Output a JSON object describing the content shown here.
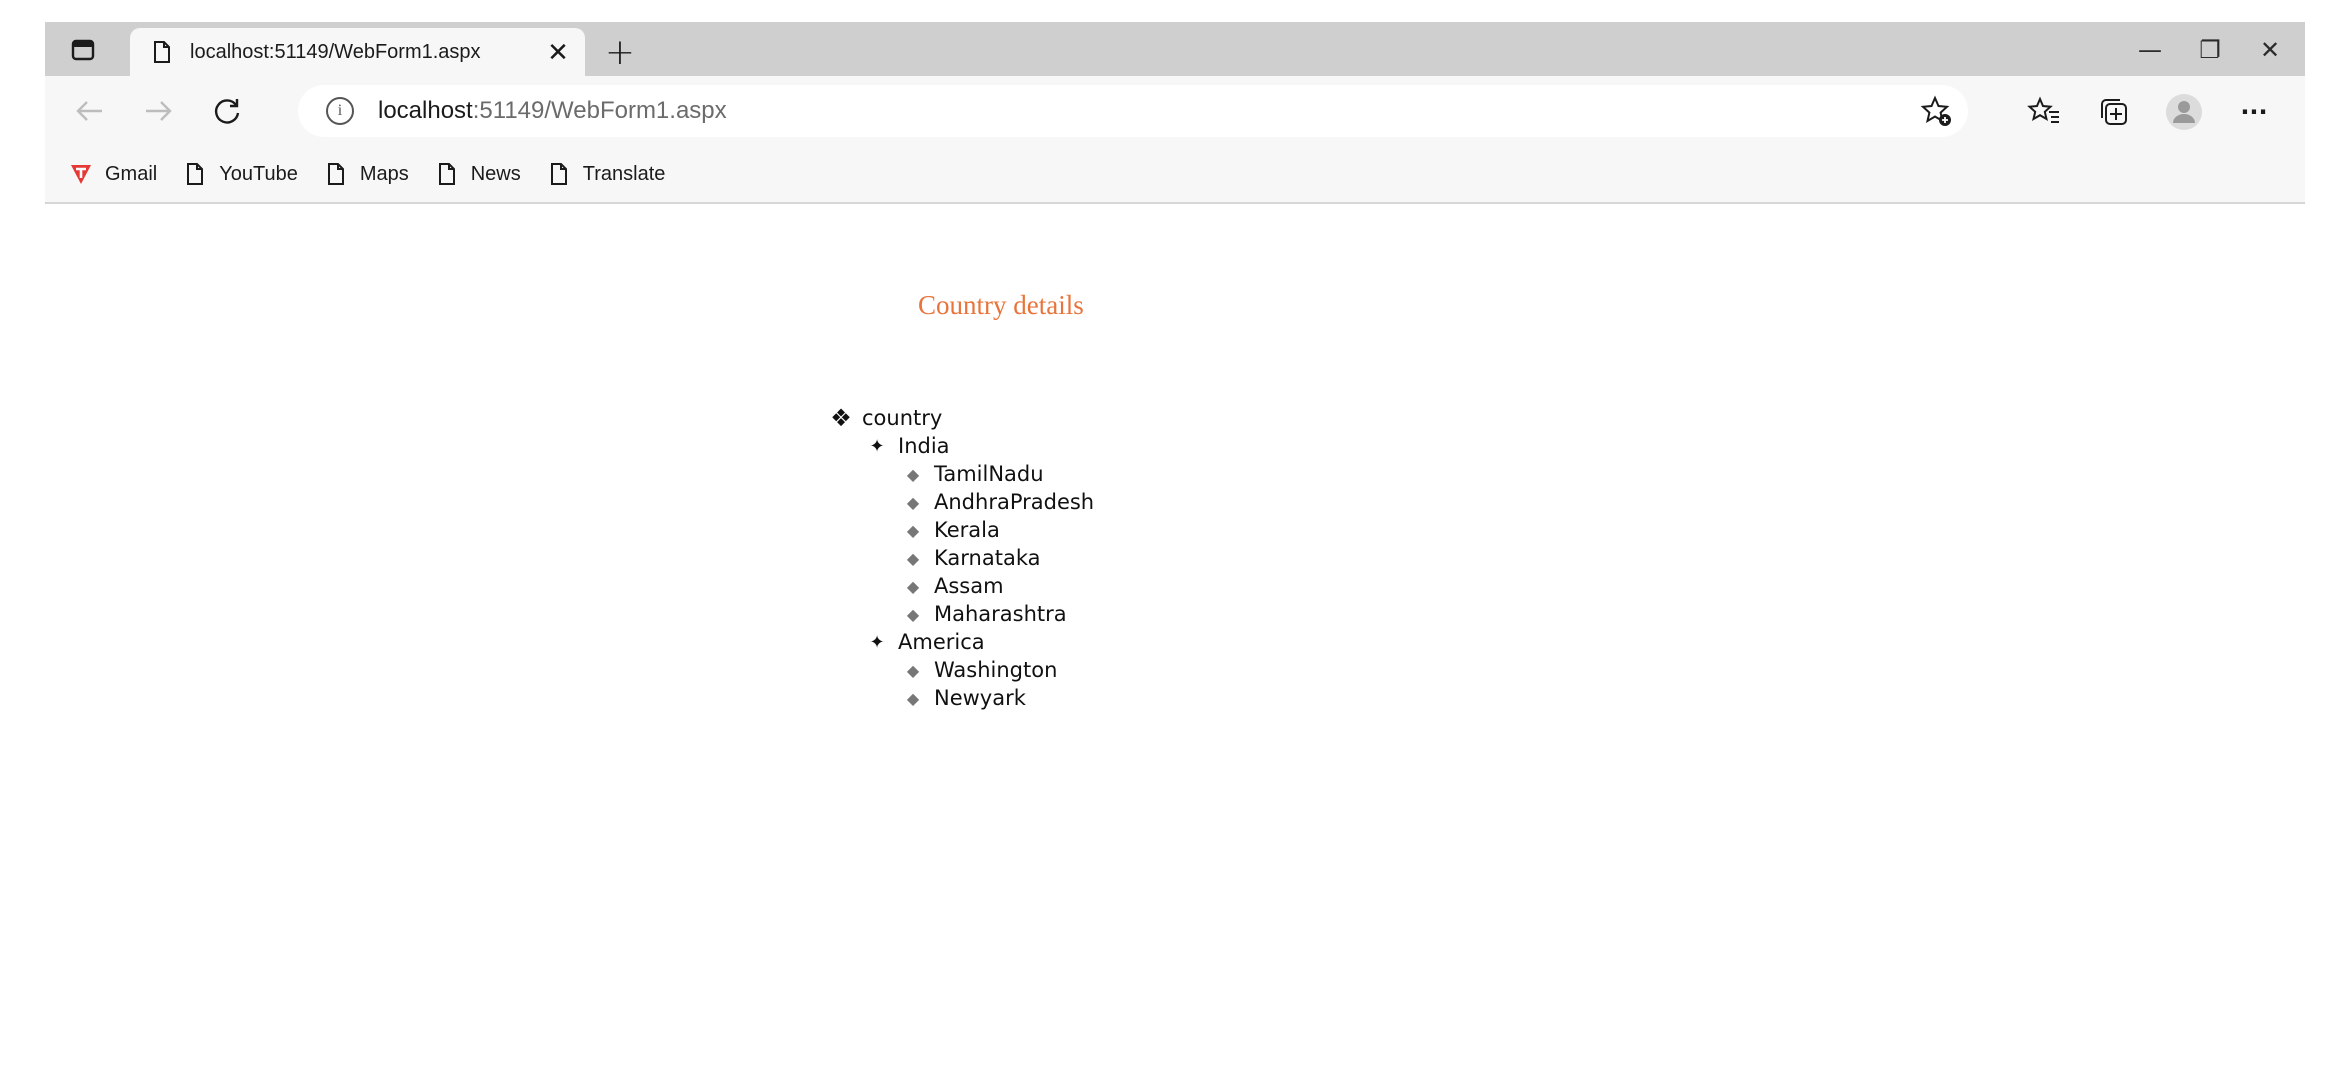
{
  "browser": {
    "tab": {
      "title": "localhost:51149/WebForm1.aspx",
      "close": "✕"
    },
    "newtab": "+",
    "window": {
      "minimize": "—",
      "restore": "❐",
      "close": "✕"
    },
    "address": {
      "host": "localhost",
      "rest": ":51149/WebForm1.aspx"
    },
    "toolbar_more": "···",
    "bookmarks": [
      {
        "label": "Gmail",
        "icon": "gmail-icon"
      },
      {
        "label": "YouTube",
        "icon": "page-icon"
      },
      {
        "label": "Maps",
        "icon": "page-icon"
      },
      {
        "label": "News",
        "icon": "page-icon"
      },
      {
        "label": "Translate",
        "icon": "page-icon"
      }
    ]
  },
  "page": {
    "heading": "Country details",
    "tree": {
      "root": "country",
      "countries": [
        {
          "name": "India",
          "states": [
            "TamilNadu",
            "AndhraPradesh",
            "Kerala",
            "Karnataka",
            "Assam",
            "Maharashtra"
          ]
        },
        {
          "name": "America",
          "states": [
            "Washington",
            "Newyark"
          ]
        }
      ]
    }
  },
  "colors": {
    "heading": "#e8743b",
    "tabstrip": "#cfcfcf",
    "toolbar": "#f7f7f7",
    "gmail": "#e53935"
  }
}
